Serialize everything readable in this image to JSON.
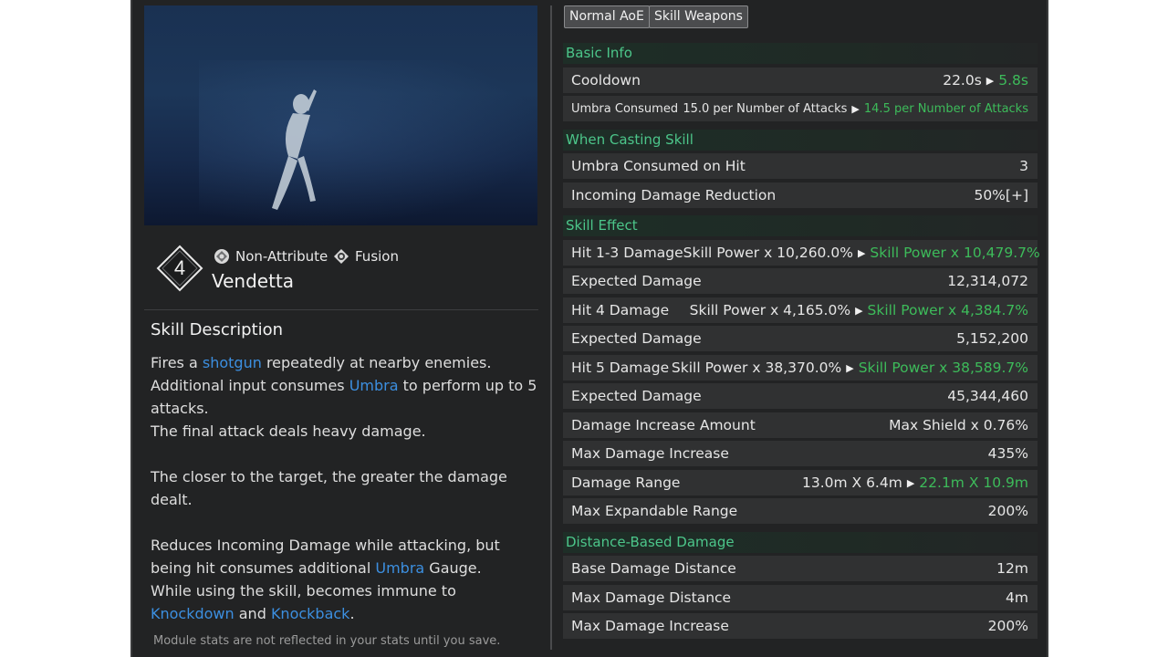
{
  "skill": {
    "level": "4",
    "name": "Vendetta",
    "tags": [
      {
        "label": "Non-Attribute",
        "icon": "non-attribute-icon"
      },
      {
        "label": "Fusion",
        "icon": "fusion-icon"
      }
    ]
  },
  "description": {
    "title": "Skill Description",
    "p1_a": "Fires a ",
    "p1_kw1": "shotgun",
    "p1_b": " repeatedly at nearby enemies.",
    "p2_a": "Additional input consumes ",
    "p2_kw1": "Umbra",
    "p2_b": " to perform up to 5 attacks.",
    "p3": "The final attack deals heavy damage.",
    "p4": "The closer to the target, the greater the damage dealt.",
    "p5": "Reduces Incoming Damage while attacking, but being hit consumes additional ",
    "p5_kw1": "Umbra",
    "p5_b": " Gauge.",
    "p6": "While using the skill, becomes immune to",
    "p7_kw1": "Knockdown",
    "p7_mid": " and ",
    "p7_kw2": "Knockback",
    "p7_end": "."
  },
  "footnote": "Module stats are not reflected in your stats until you save.",
  "filters": [
    "Normal AoE",
    "Skill Weapons"
  ],
  "sections": {
    "basic_info": "Basic Info",
    "when_casting": "When Casting Skill",
    "skill_effect": "Skill Effect",
    "distance_based": "Distance-Based Damage"
  },
  "rows": {
    "cooldown": {
      "label": "Cooldown",
      "base": "22.0s",
      "upgraded": "5.8s"
    },
    "umbra_consumed": {
      "label": "Umbra Consumed",
      "base": "15.0 per Number of Attacks",
      "upgraded": "14.5 per Number of Attacks"
    },
    "umbra_on_hit": {
      "label": "Umbra Consumed on Hit",
      "value": "3"
    },
    "incoming_reduction": {
      "label": "Incoming Damage Reduction",
      "value": "50%[+]"
    },
    "hit13": {
      "label": "Hit 1-3 Damage",
      "base": "Skill Power x 10,260.0%",
      "upgraded": "Skill Power x 10,479.7%"
    },
    "exp1": {
      "label": "Expected Damage",
      "value": "12,314,072"
    },
    "hit4": {
      "label": "Hit 4 Damage",
      "base": "Skill Power x 4,165.0%",
      "upgraded": "Skill Power x 4,384.7%"
    },
    "exp2": {
      "label": "Expected Damage",
      "value": "5,152,200"
    },
    "hit5": {
      "label": "Hit 5 Damage",
      "base": "Skill Power x 38,370.0%",
      "upgraded": "Skill Power x 38,589.7%"
    },
    "exp3": {
      "label": "Expected Damage",
      "value": "45,344,460"
    },
    "dmg_inc_amount": {
      "label": "Damage Increase Amount",
      "value": "Max Shield x 0.76%"
    },
    "max_dmg_inc": {
      "label": "Max Damage Increase",
      "value": "435%"
    },
    "dmg_range": {
      "label": "Damage Range",
      "base": "13.0m X 6.4m",
      "upgraded": "22.1m X 10.9m"
    },
    "max_exp_range": {
      "label": "Max Expandable Range",
      "value": "200%"
    },
    "base_dmg_dist": {
      "label": "Base Damage Distance",
      "value": "12m"
    },
    "max_dmg_dist": {
      "label": "Max Damage Distance",
      "value": "4m"
    },
    "max_dmg_inc2": {
      "label": "Max Damage Increase",
      "value": "200%"
    }
  },
  "colors": {
    "panel": "#222324",
    "section_header": "#4cc68a",
    "upgrade": "#3dbb5a",
    "keyword": "#3c8fe0"
  }
}
